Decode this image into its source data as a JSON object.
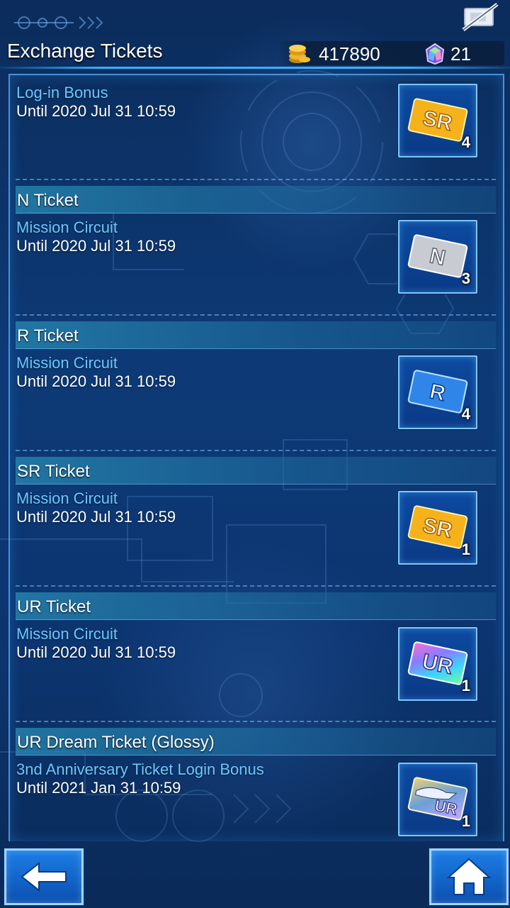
{
  "header": {
    "title": "Exchange Tickets",
    "gold": "417890",
    "gems": "21"
  },
  "entries": [
    {
      "name": "",
      "source": "Log-in Bonus",
      "until": "Until 2020 Jul 31 10:59",
      "ticket": {
        "label": "SR",
        "count": "4",
        "icon": "sr-ticket-icon"
      }
    },
    {
      "name": "N Ticket",
      "source": "Mission Circuit",
      "until": "Until 2020 Jul 31 10:59",
      "ticket": {
        "label": "N",
        "count": "3",
        "icon": "n-ticket-icon"
      }
    },
    {
      "name": "R Ticket",
      "source": "Mission Circuit",
      "until": "Until 2020 Jul 31 10:59",
      "ticket": {
        "label": "R",
        "count": "4",
        "icon": "r-ticket-icon"
      }
    },
    {
      "name": "SR Ticket",
      "source": "Mission Circuit",
      "until": "Until 2020 Jul 31 10:59",
      "ticket": {
        "label": "SR",
        "count": "1",
        "icon": "sr-ticket-icon"
      }
    },
    {
      "name": "UR Ticket",
      "source": "Mission Circuit",
      "until": "Until 2020 Jul 31 10:59",
      "ticket": {
        "label": "UR",
        "count": "1",
        "icon": "ur-ticket-icon"
      }
    },
    {
      "name": "UR Dream Ticket (Glossy)",
      "source": "3nd Anniversary Ticket Login Bonus",
      "until": "Until 2021 Jan 31 10:59",
      "ticket": {
        "label": "UR",
        "count": "1",
        "icon": "ur-dream-ticket-icon"
      }
    }
  ],
  "nav": {
    "back_icon": "back-arrow-icon",
    "home_icon": "home-icon"
  },
  "colors": {
    "accent": "#3ab0ff",
    "source_text": "#6cc8ff",
    "sr": "#f5b21a",
    "n": "#c8ccd2",
    "r": "#2f86e8"
  }
}
